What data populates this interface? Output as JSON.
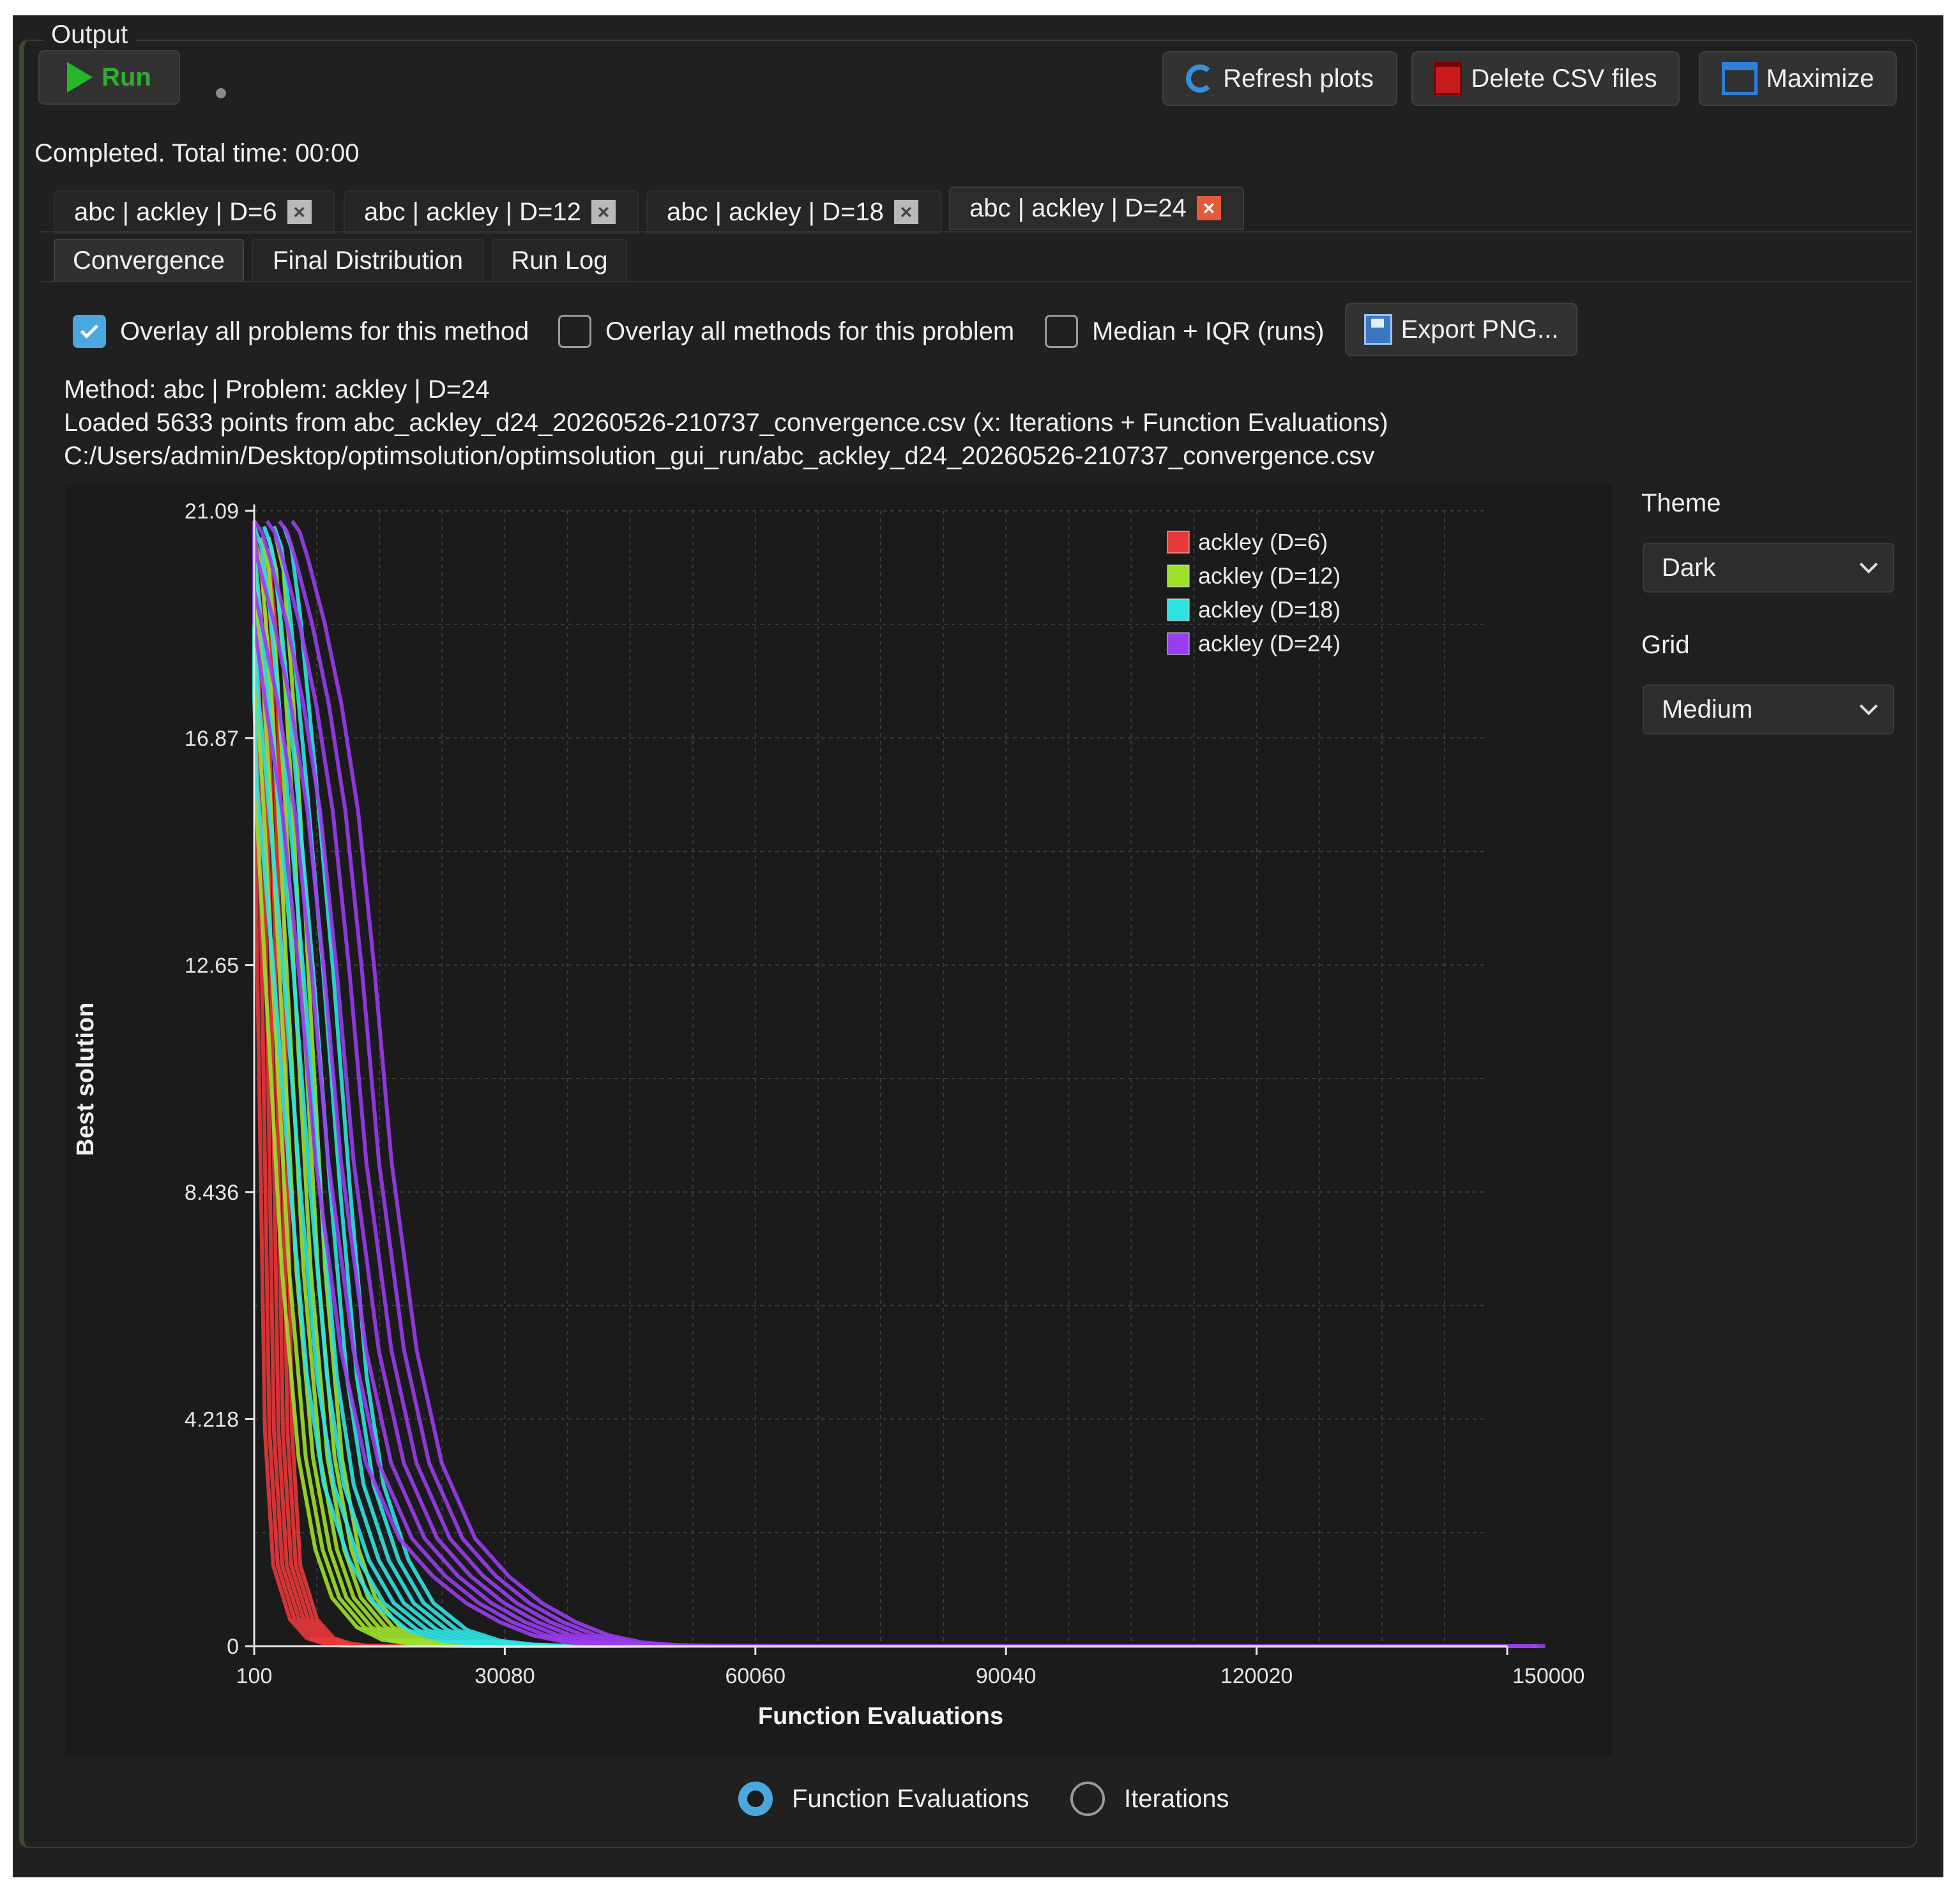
{
  "group_title": "Output",
  "toolbar": {
    "run_label": "Run",
    "refresh_label": "Refresh plots",
    "delete_label": "Delete CSV files",
    "maximize_label": "Maximize"
  },
  "status_text": "Completed. Total time: 00:00",
  "file_tabs": [
    {
      "label": "abc | ackley | D=6"
    },
    {
      "label": "abc | ackley | D=12"
    },
    {
      "label": "abc | ackley | D=18"
    },
    {
      "label": "abc | ackley | D=24",
      "active": true
    }
  ],
  "sub_tabs": [
    {
      "label": "Convergence",
      "active": true
    },
    {
      "label": "Final Distribution"
    },
    {
      "label": "Run Log"
    }
  ],
  "options": {
    "overlay_problems": {
      "label": "Overlay all problems for this method",
      "checked": true
    },
    "overlay_methods": {
      "label": "Overlay all methods for this problem",
      "checked": false
    },
    "median_iqr": {
      "label": "Median + IQR (runs)",
      "checked": false
    },
    "export_label": "Export PNG..."
  },
  "info": {
    "line1": "Method: abc | Problem: ackley | D=24",
    "line2": "Loaded 5633 points from abc_ackley_d24_20260526-210737_convergence.csv (x: Iterations + Function Evaluations)",
    "line3": "C:/Users/admin/Desktop/optimsolution/optimsolution_gui_run/abc_ackley_d24_20260526-210737_convergence.csv"
  },
  "side_panel": {
    "theme_label": "Theme",
    "theme_value": "Dark",
    "grid_label": "Grid",
    "grid_value": "Medium"
  },
  "x_axis_mode": {
    "function_evaluations": {
      "label": "Function Evaluations",
      "selected": true
    },
    "iterations": {
      "label": "Iterations",
      "selected": false
    }
  },
  "chart_data": {
    "type": "line",
    "xlabel": "Function Evaluations",
    "ylabel": "Best solution",
    "xlim": [
      100,
      150000
    ],
    "ylim": [
      0,
      21.09
    ],
    "x_ticks": [
      "100",
      "30080",
      "60060",
      "90040",
      "120020",
      "150000"
    ],
    "y_ticks": [
      "0",
      "4.218",
      "8.436",
      "12.65",
      "16.87",
      "21.09"
    ],
    "grid": true,
    "legend_position": "top-right",
    "x": [
      100,
      1000,
      2000,
      3000,
      4000,
      6000,
      8000,
      10000,
      12000,
      15000,
      18000,
      22000,
      26000,
      30000,
      34000,
      38000,
      42000,
      46000,
      50000,
      60000,
      90000,
      120000,
      150000
    ],
    "series": [
      {
        "name": "ackley (D=6)",
        "color": "#e8393b",
        "values": [
          20.4,
          19.0,
          13.5,
          4.0,
          1.5,
          0.5,
          0.15,
          0.05,
          0.01,
          0,
          0,
          0,
          0,
          0,
          0,
          0,
          0,
          0,
          0,
          0,
          0,
          0,
          0
        ]
      },
      {
        "name": "ackley (D=12)",
        "color": "#9ee02e",
        "values": [
          20.6,
          20.0,
          18.0,
          15.5,
          12.5,
          7.0,
          3.5,
          1.8,
          0.9,
          0.35,
          0.12,
          0.03,
          0.01,
          0,
          0,
          0,
          0,
          0,
          0,
          0,
          0,
          0,
          0
        ]
      },
      {
        "name": "ackley (D=18)",
        "color": "#2fe3e0",
        "values": [
          20.8,
          20.4,
          19.2,
          17.6,
          16.0,
          12.5,
          8.5,
          5.0,
          3.0,
          1.6,
          0.8,
          0.3,
          0.1,
          0.03,
          0.01,
          0,
          0,
          0,
          0,
          0,
          0,
          0,
          0
        ]
      },
      {
        "name": "ackley (D=24)",
        "color": "#9a3df0",
        "values": [
          20.9,
          20.7,
          20.2,
          19.6,
          19.0,
          17.5,
          15.5,
          12.5,
          9.0,
          5.5,
          3.4,
          2.0,
          1.3,
          0.8,
          0.45,
          0.2,
          0.07,
          0.02,
          0.01,
          0,
          0,
          0,
          0
        ]
      }
    ]
  }
}
